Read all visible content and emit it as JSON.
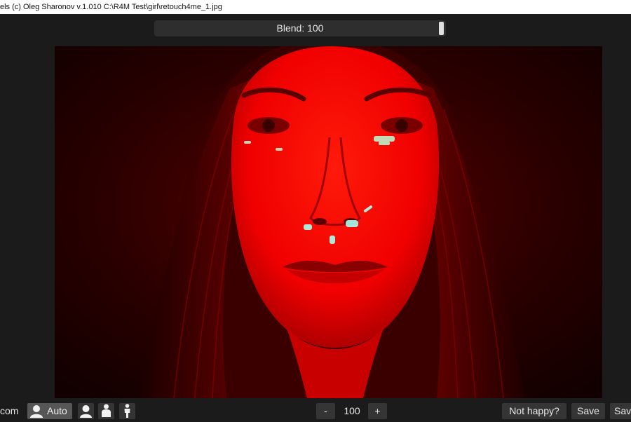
{
  "window": {
    "title": "els (c) Oleg Sharonov v.1.010 C:\\R4M Test\\girl\\retouch4me_1.jpg"
  },
  "blend": {
    "label": "Blend: 100",
    "value": 100
  },
  "image": {
    "description_icon": "portrait-photo",
    "tint": "#ff0000"
  },
  "toolbar": {
    "left_text": "com",
    "auto_label": "Auto",
    "mode_icons": [
      "person-head-icon",
      "person-bust-icon",
      "person-full-icon"
    ],
    "zoom_minus": "-",
    "zoom_value": "100",
    "zoom_plus": "+",
    "not_happy_label": "Not happy?",
    "save_label": "Save",
    "save_as_label": "Sav"
  }
}
